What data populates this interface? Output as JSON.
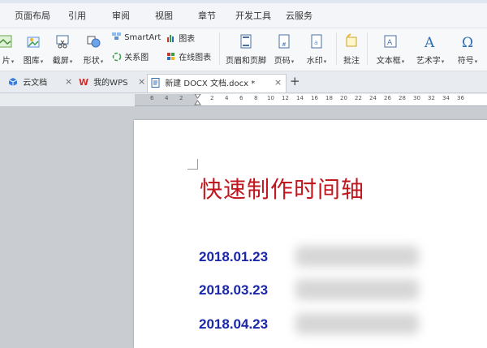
{
  "menu": {
    "items": [
      "页面布局",
      "引用",
      "审阅",
      "视图",
      "章节",
      "开发工具",
      "云服务"
    ]
  },
  "toolbar": {
    "picture_label": "片",
    "gallery_label": "图库",
    "screenshot_label": "截屏",
    "shapes_label": "形状",
    "smartart_label": "SmartArt",
    "relation_label": "关系图",
    "chart_label": "图表",
    "online_chart_label": "在线图表",
    "header_footer_label": "页眉和页脚",
    "page_number_label": "页码",
    "watermark_label": "水印",
    "comment_label": "批注",
    "textbox_label": "文本框",
    "wordart_label": "艺术字",
    "symbol_label": "符号"
  },
  "tabs": [
    {
      "label": "云文档"
    },
    {
      "label": "我的WPS"
    },
    {
      "label": "新建 DOCX 文档.docx *"
    }
  ],
  "ruler": {
    "numbers": [
      "6",
      "4",
      "2",
      "2",
      "4",
      "6",
      "8",
      "10",
      "12",
      "14",
      "16",
      "18",
      "20",
      "22",
      "24",
      "26",
      "28",
      "30",
      "32",
      "34",
      "36"
    ]
  },
  "document": {
    "title": "快速制作时间轴",
    "dates": [
      "2018.01.23",
      "2018.03.23",
      "2018.04.23"
    ]
  },
  "colors": {
    "title": "#c0171f",
    "dates": "#1a27a8"
  }
}
